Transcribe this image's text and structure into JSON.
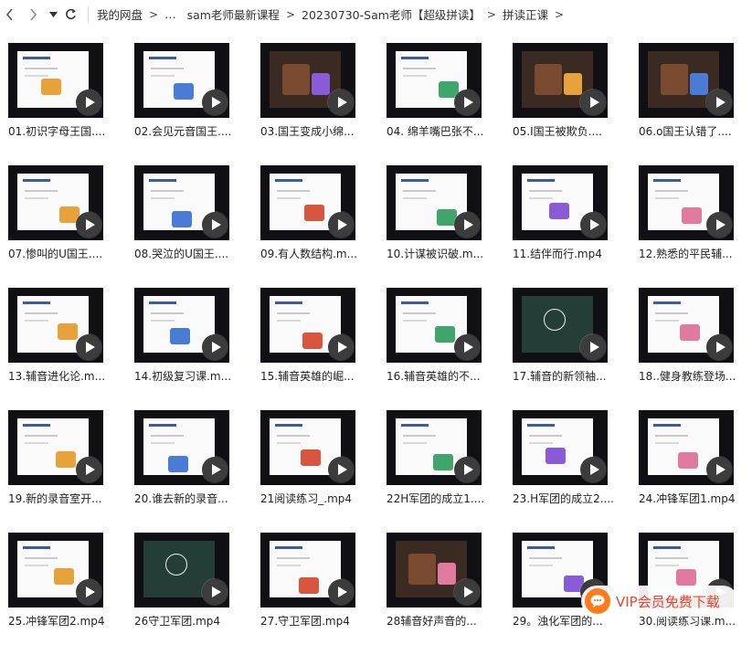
{
  "breadcrumb": {
    "items": [
      "我的网盘",
      "…",
      "sam老师最新课程",
      "20230730-Sam老师【超级拼读】",
      "拼读正课"
    ],
    "separator": ">"
  },
  "icons": {
    "back": "chevron-left-icon",
    "forward": "chevron-right-icon",
    "dropdown": "caret-down-icon",
    "refresh": "refresh-icon",
    "play": "play-icon",
    "vip": "chat-bubble-icon"
  },
  "files": [
    {
      "name": "01.初识字母王国....",
      "theme": "light"
    },
    {
      "name": "02.会见元音国王....",
      "theme": "light"
    },
    {
      "name": "03.国王变成小绵...",
      "theme": "dark"
    },
    {
      "name": "04. 绵羊嘴巴张不...",
      "theme": "light"
    },
    {
      "name": "05.I国王被欺负....",
      "theme": "dark"
    },
    {
      "name": "06.o国王认错了....",
      "theme": "dark"
    },
    {
      "name": "07.惨叫的U国王....",
      "theme": "light"
    },
    {
      "name": "08.哭泣的U国王....",
      "theme": "light"
    },
    {
      "name": "09.有人数结构.m...",
      "theme": "light"
    },
    {
      "name": "10.计谋被识破.m...",
      "theme": "light"
    },
    {
      "name": "11.结伴而行.mp4",
      "theme": "light"
    },
    {
      "name": "12.熟悉的平民辅...",
      "theme": "light"
    },
    {
      "name": "13.辅音进化论.m...",
      "theme": "light"
    },
    {
      "name": "14.初级复习课.m...",
      "theme": "light"
    },
    {
      "name": "15.辅音英雄的崛...",
      "theme": "light"
    },
    {
      "name": "16.辅音英雄的不...",
      "theme": "light"
    },
    {
      "name": "17.辅音的新领袖...",
      "theme": "board"
    },
    {
      "name": "18..健身教练登场...",
      "theme": "light"
    },
    {
      "name": "19.新的录音室开...",
      "theme": "light"
    },
    {
      "name": "20.谁去新的录音...",
      "theme": "light"
    },
    {
      "name": "21阅读练习_.mp4",
      "theme": "light"
    },
    {
      "name": "22H军团的成立1....",
      "theme": "light"
    },
    {
      "name": "23.H军团的成立2....",
      "theme": "light"
    },
    {
      "name": "24.冲锋军团1.mp4",
      "theme": "light"
    },
    {
      "name": "25.冲锋军团2.mp4",
      "theme": "light"
    },
    {
      "name": "26守卫军团.mp4",
      "theme": "board"
    },
    {
      "name": "27.守卫军团.mp4",
      "theme": "light"
    },
    {
      "name": "28辅音好声音的...",
      "theme": "dark"
    },
    {
      "name": "29。浊化军团的...",
      "theme": "light"
    },
    {
      "name": "30.阅读练习课.m...",
      "theme": "light"
    }
  ],
  "vip_banner": {
    "text": "VIP会员免费下载"
  },
  "colors": {
    "play_button": "#3c3c3c",
    "vip_text": "#e8452c",
    "vip_icon": "#ff7a1a",
    "video_frame": "#0f0f14"
  }
}
